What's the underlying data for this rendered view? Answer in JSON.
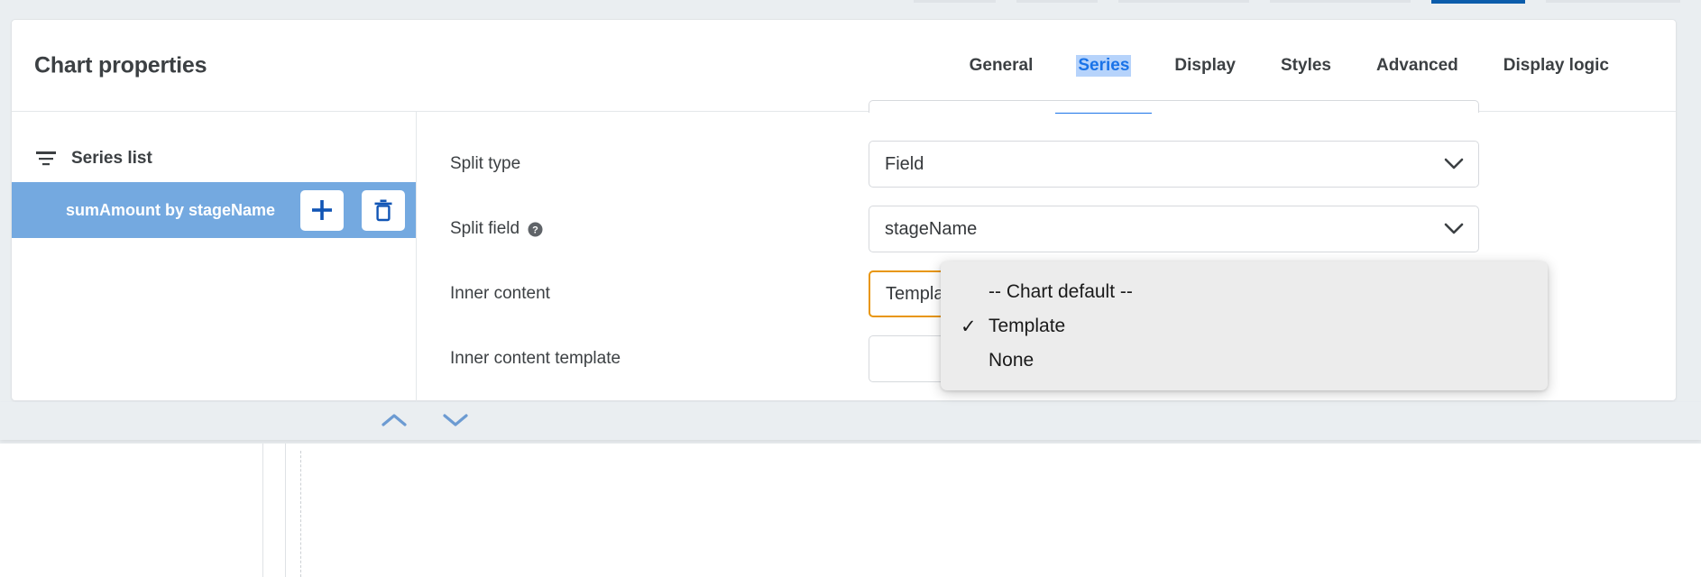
{
  "header": {
    "title": "Chart properties"
  },
  "tabs": [
    {
      "label": "General",
      "active": false
    },
    {
      "label": "Series",
      "active": true
    },
    {
      "label": "Display",
      "active": false
    },
    {
      "label": "Styles",
      "active": false
    },
    {
      "label": "Advanced",
      "active": false
    },
    {
      "label": "Display logic",
      "active": false
    }
  ],
  "sidebar": {
    "heading": "Series list",
    "heading_icon": "filter-list-icon",
    "items": [
      {
        "label": "sumAmount by stageName",
        "selected": true,
        "add_icon": "plus-icon",
        "delete_icon": "trash-icon"
      }
    ]
  },
  "form": {
    "split_type": {
      "label": "Split type",
      "value": "Field",
      "chevron_icon": "chevron-down-icon"
    },
    "split_field": {
      "label": "Split field",
      "help_icon": "help-circle-icon",
      "value": "stageName",
      "chevron_icon": "chevron-down-icon"
    },
    "inner_content": {
      "label": "Inner content",
      "value": "Template",
      "chevron_icon": "chevron-down-icon",
      "focused": true,
      "focus_color": "#e8960c"
    },
    "inner_content_template": {
      "label": "Inner content template",
      "value": "",
      "placeholder": "",
      "resize_handle_icon": "resize-grip-icon",
      "buttons": [
        {
          "icon": "document-edit-icon",
          "name": "open-template-editor-button"
        },
        {
          "icon": "code-brackets-icon",
          "name": "open-code-editor-button"
        }
      ]
    }
  },
  "dropdown": {
    "open": true,
    "options": [
      {
        "label": "-- Chart default --",
        "checked": false
      },
      {
        "label": "Template",
        "checked": true
      },
      {
        "label": "None",
        "checked": false
      }
    ],
    "check_glyph": "✓"
  },
  "footer": {
    "scroll_up_icon": "chevron-up-icon",
    "scroll_down_icon": "chevron-down-icon"
  },
  "colors": {
    "accent_blue": "#1a73e8",
    "selected_row_blue": "#74a9e0",
    "focus_orange": "#e8960c",
    "icon_blue": "#1155b5",
    "page_bg": "#eaeef1",
    "tab_highlight": "#b6d3fb"
  }
}
